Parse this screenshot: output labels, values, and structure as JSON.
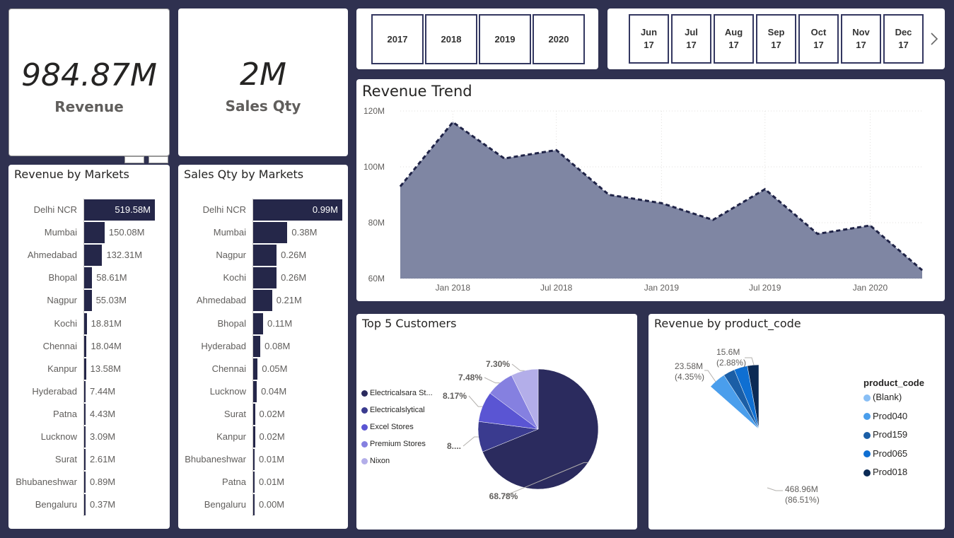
{
  "kpis": {
    "revenue": {
      "value": "984.87M",
      "label": "Revenue"
    },
    "qty": {
      "value": "2M",
      "label": "Sales Qty"
    }
  },
  "year_slicer": [
    "2017",
    "2018",
    "2019",
    "2020"
  ],
  "month_slicer": {
    "items": [
      "Jun\n17",
      "Jul\n17",
      "Aug\n17",
      "Sep\n17",
      "Oct\n17",
      "Nov\n17",
      "Dec\n17"
    ],
    "next_icon": "chevron-right-icon"
  },
  "revenue_by_markets": {
    "title": "Revenue by Markets",
    "rows": [
      {
        "market": "Delhi NCR",
        "label": "519.58M",
        "value": 519.58
      },
      {
        "market": "Mumbai",
        "label": "150.08M",
        "value": 150.08
      },
      {
        "market": "Ahmedabad",
        "label": "132.31M",
        "value": 132.31
      },
      {
        "market": "Bhopal",
        "label": "58.61M",
        "value": 58.61
      },
      {
        "market": "Nagpur",
        "label": "55.03M",
        "value": 55.03
      },
      {
        "market": "Kochi",
        "label": "18.81M",
        "value": 18.81
      },
      {
        "market": "Chennai",
        "label": "18.04M",
        "value": 18.04
      },
      {
        "market": "Kanpur",
        "label": "13.58M",
        "value": 13.58
      },
      {
        "market": "Hyderabad",
        "label": "7.44M",
        "value": 7.44
      },
      {
        "market": "Patna",
        "label": "4.43M",
        "value": 4.43
      },
      {
        "market": "Lucknow",
        "label": "3.09M",
        "value": 3.09
      },
      {
        "market": "Surat",
        "label": "2.61M",
        "value": 2.61
      },
      {
        "market": "Bhubaneshwar",
        "label": "0.89M",
        "value": 0.89
      },
      {
        "market": "Bengaluru",
        "label": "0.37M",
        "value": 0.37
      }
    ]
  },
  "qty_by_markets": {
    "title": "Sales Qty by Markets",
    "rows": [
      {
        "market": "Delhi NCR",
        "label": "0.99M",
        "value": 0.99
      },
      {
        "market": "Mumbai",
        "label": "0.38M",
        "value": 0.38
      },
      {
        "market": "Nagpur",
        "label": "0.26M",
        "value": 0.26
      },
      {
        "market": "Kochi",
        "label": "0.26M",
        "value": 0.26
      },
      {
        "market": "Ahmedabad",
        "label": "0.21M",
        "value": 0.21
      },
      {
        "market": "Bhopal",
        "label": "0.11M",
        "value": 0.11
      },
      {
        "market": "Hyderabad",
        "label": "0.08M",
        "value": 0.08
      },
      {
        "market": "Chennai",
        "label": "0.05M",
        "value": 0.05
      },
      {
        "market": "Lucknow",
        "label": "0.04M",
        "value": 0.04
      },
      {
        "market": "Surat",
        "label": "0.02M",
        "value": 0.02
      },
      {
        "market": "Kanpur",
        "label": "0.02M",
        "value": 0.02
      },
      {
        "market": "Bhubaneshwar",
        "label": "0.01M",
        "value": 0.01
      },
      {
        "market": "Patna",
        "label": "0.01M",
        "value": 0.01
      },
      {
        "market": "Bengaluru",
        "label": "0.00M",
        "value": 0.0
      }
    ]
  },
  "chart_data": [
    {
      "type": "area",
      "title": "Revenue Trend",
      "x": [
        "2017-10",
        "2018-01",
        "2018-04",
        "2018-07",
        "2018-10",
        "2019-01",
        "2019-04",
        "2019-07",
        "2019-10",
        "2020-01",
        "2020-04"
      ],
      "values": [
        93,
        116,
        103,
        106,
        90,
        87,
        81,
        92,
        76,
        79,
        63
      ],
      "x_ticks": [
        "Jan 2018",
        "Jul 2018",
        "Jan 2019",
        "Jul 2019",
        "Jan 2020"
      ],
      "y_ticks": [
        "60M",
        "80M",
        "100M",
        "120M"
      ],
      "ylim": [
        60,
        120
      ],
      "grid": true,
      "fill_color": "#7f86a3",
      "line_color": "#1f2347"
    },
    {
      "type": "pie",
      "title": "Top 5 Customers",
      "slices": [
        {
          "name": "Electricalsara St...",
          "value": 68.78,
          "label": "68.78%",
          "color": "#2b2b5e"
        },
        {
          "name": "Electricalslytical",
          "value": 8.2,
          "label": "8....",
          "color": "#3a3b8f"
        },
        {
          "name": "Excel Stores",
          "value": 8.17,
          "label": "8.17%",
          "color": "#5a55d3"
        },
        {
          "name": "Premium Stores",
          "value": 7.48,
          "label": "7.48%",
          "color": "#8580e0"
        },
        {
          "name": "Nixon",
          "value": 7.3,
          "label": "7.30%",
          "color": "#b3aee9"
        }
      ],
      "legend_position": "left"
    },
    {
      "type": "pie",
      "title": "Revenue by product_code",
      "legend_title": "product_code",
      "slices": [
        {
          "name": "(Blank)",
          "value": 86.51,
          "label": "468.96M\n(86.51%)",
          "color": "#89bff5"
        },
        {
          "name": "Prod040",
          "value": 4.35,
          "label": "23.58M\n(4.35%)",
          "color": "#4a9eec"
        },
        {
          "name": "Prod159",
          "value": 2.9,
          "label": "",
          "color": "#1b5ea6"
        },
        {
          "name": "Prod065",
          "value": 3.36,
          "label": "",
          "color": "#0f6fd2"
        },
        {
          "name": "Prod018",
          "value": 2.88,
          "label": "15.6M\n(2.88%)",
          "color": "#0b2a55"
        }
      ],
      "legend_position": "right"
    }
  ]
}
